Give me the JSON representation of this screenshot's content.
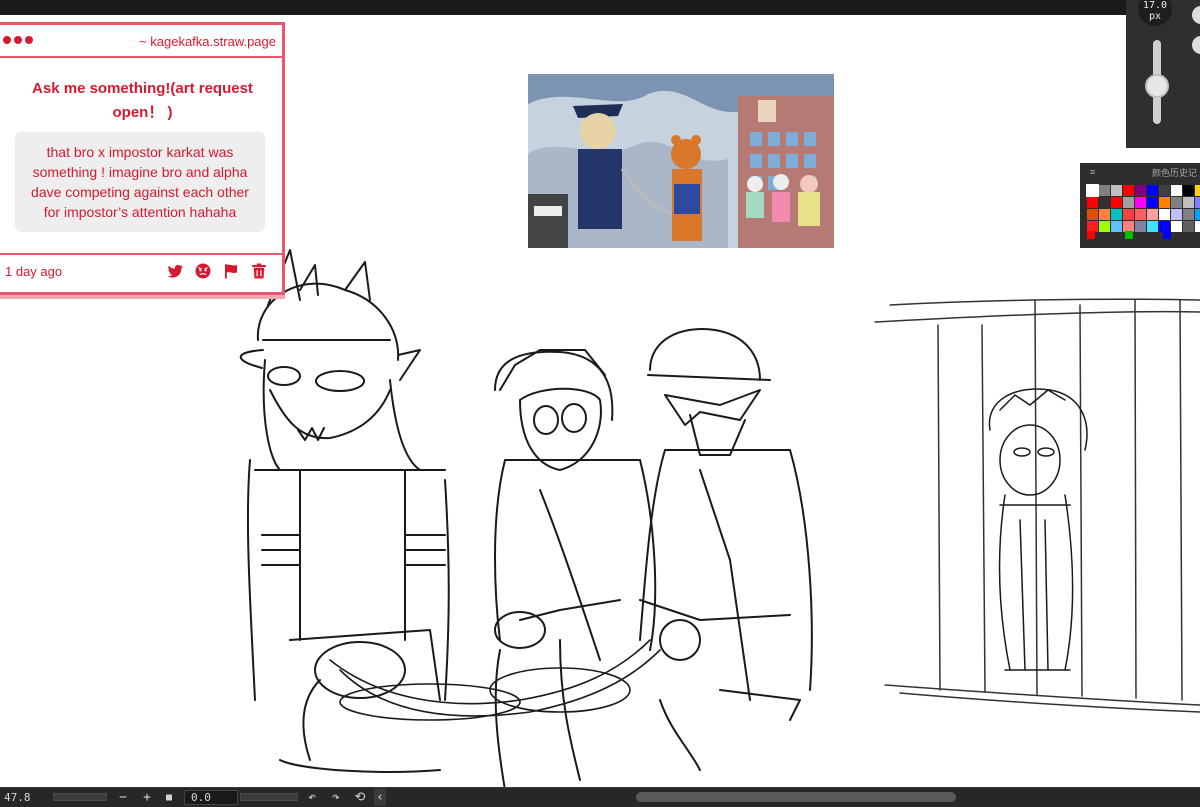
{
  "ask": {
    "host": "~ kagekafka.straw.page",
    "title": "Ask me something!(art request open！ )",
    "message": "that bro x impostor karkat was something ! imagine bro and alpha dave competing against each other for impostor’s attention hahaha",
    "time": "1 day ago",
    "icons": [
      "twitter-icon",
      "angry-face-icon",
      "flag-icon",
      "trash-icon"
    ],
    "accent": "#d7192f"
  },
  "brush": {
    "size_value": "17.0",
    "size_unit": "px",
    "level": 0.45
  },
  "color_panel": {
    "title": "颜色历史记",
    "menu": "≡",
    "swatches": [
      "#ffffff",
      "#808080",
      "#c0c0c0",
      "#ff0000",
      "#800080",
      "#0000ff",
      "#404040",
      "#ffffff",
      "#000000",
      "#ffd200",
      "#ff0000",
      "#303030",
      "#ff0000",
      "#a0a0a0",
      "#ff00ff",
      "#0000ff",
      "#ff8000",
      "#808080",
      "#c0c0c0",
      "#8080ff",
      "#e05000",
      "#ff8040",
      "#00c0c0",
      "#ff4040",
      "#ff6060",
      "#ffa0a0",
      "#ffffff",
      "#c0c0ff",
      "#808080",
      "#00a0ff",
      "#ff2020",
      "#a0ff00",
      "#60c0ff",
      "#ff8080",
      "#8080a0",
      "#40e0ff",
      "#0000ff",
      "#ffffff",
      "#606060",
      "#ffffff"
    ],
    "recent": [
      "#ff0000",
      "#00c000",
      "#0000ff"
    ]
  },
  "status": {
    "zoom": "47.8",
    "zoom_out": "−",
    "zoom_in": "+",
    "fit": "■",
    "angle": "0.0",
    "undo": "↶",
    "redo": "↷",
    "reset": "⟲",
    "collapse": "‹"
  }
}
